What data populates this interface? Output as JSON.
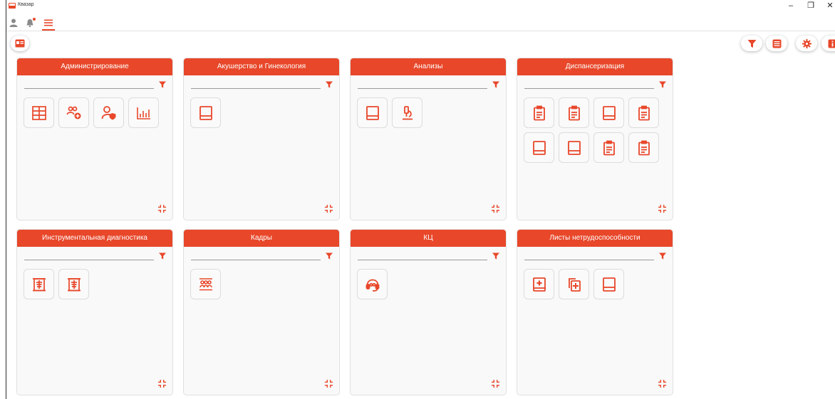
{
  "app": {
    "title": "Квазар"
  },
  "window_controls": {
    "minimize": "–",
    "restore": "❐",
    "close": "✕"
  },
  "accent_color": "#e8472a",
  "toolbar": {
    "icons": [
      "user-icon",
      "bell-icon",
      "menu-icon"
    ]
  },
  "right_actions": [
    "filter-icon",
    "list-icon",
    "settings-icon",
    "info-icon"
  ],
  "cards": [
    {
      "title": "Администрирование",
      "icons": [
        "schedule-grid-icon",
        "users-add-icon",
        "user-shield-icon",
        "bar-chart-icon"
      ]
    },
    {
      "title": "Акушерство и Гинекология",
      "icons": [
        "book-icon"
      ]
    },
    {
      "title": "Анализы",
      "icons": [
        "book-icon",
        "microscope-icon"
      ]
    },
    {
      "title": "Диспансеризация",
      "icons": [
        "clipboard-icon",
        "clipboard-icon",
        "book-icon",
        "clipboard-icon",
        "book-icon",
        "book-icon",
        "clipboard-icon",
        "clipboard-icon"
      ]
    },
    {
      "title": "Инструментальная диагностика",
      "icons": [
        "xray-icon",
        "xray-icon"
      ]
    },
    {
      "title": "Кадры",
      "icons": [
        "staff-icon"
      ]
    },
    {
      "title": "КЦ",
      "icons": [
        "headset-icon"
      ]
    },
    {
      "title": "Листы нетрудоспособности",
      "icons": [
        "medical-sheet-icon",
        "medical-copy-icon",
        "book-icon"
      ]
    }
  ]
}
